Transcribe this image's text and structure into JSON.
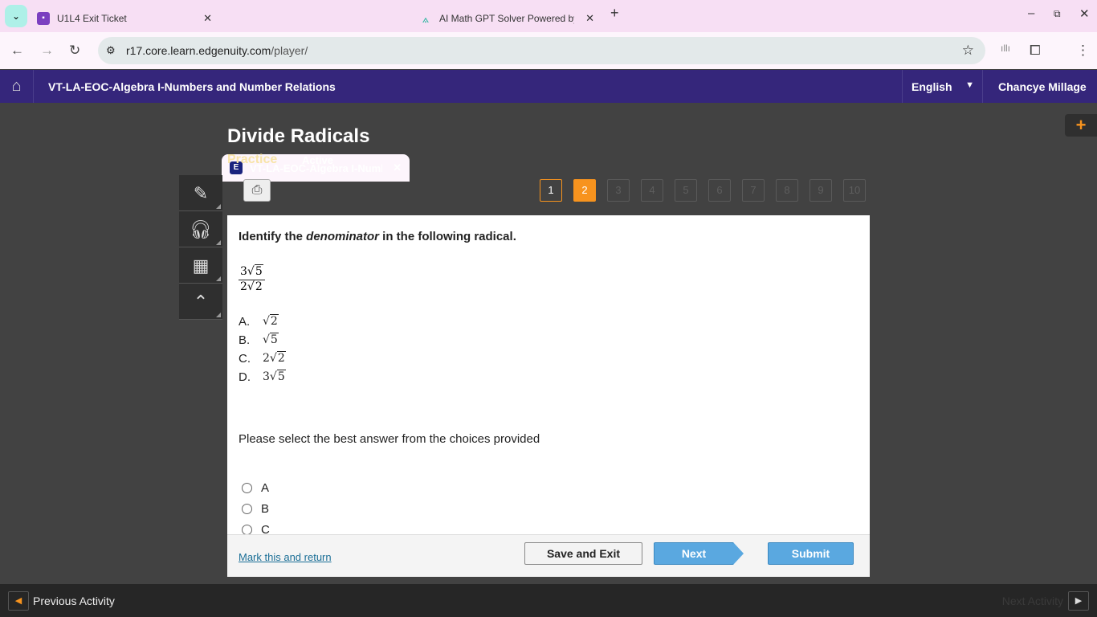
{
  "browser": {
    "tabs": [
      {
        "title": "U1L4 Exit Ticket",
        "icon": "classroom-icon",
        "color": "#7b3fc0"
      },
      {
        "title": "VT-LA-EOC-Algebra I-Numbers and Number Relations",
        "icon": "edgenuity-icon",
        "color": "#1a237e",
        "active": true
      },
      {
        "title": "AI Math GPT Solver Powered by AI",
        "icon": "compass-icon",
        "color": "#2bb5a0"
      }
    ],
    "url_host": "r17.core.learn.edgenuity.com",
    "url_path": "/player/"
  },
  "header": {
    "course": "VT-LA-EOC-Algebra I-Numbers and Number Relations",
    "language": "English",
    "user": "Chancye Millage"
  },
  "lesson": {
    "title": "Divide Radicals",
    "type": "Practice",
    "status": "Active"
  },
  "pages": {
    "items": [
      "1",
      "2",
      "3",
      "4",
      "5",
      "6",
      "7",
      "8",
      "9",
      "10"
    ],
    "current": 2,
    "completed": [
      1
    ]
  },
  "question": {
    "prefix": "Identify the ",
    "emph": "denominator",
    "suffix": " in the following radical.",
    "numerator": {
      "coef": "3",
      "radicand": "5"
    },
    "denominator": {
      "coef": "2",
      "radicand": "2"
    },
    "choices": [
      {
        "letter": "A.",
        "coef": "",
        "radicand": "2"
      },
      {
        "letter": "B.",
        "coef": "",
        "radicand": "5"
      },
      {
        "letter": "C.",
        "coef": "2",
        "radicand": "2"
      },
      {
        "letter": "D.",
        "coef": "3",
        "radicand": "5"
      }
    ],
    "prompt": "Please select the best answer from the choices provided",
    "options": [
      "A",
      "B",
      "C"
    ]
  },
  "footer": {
    "mark": "Mark this and return",
    "save": "Save and Exit",
    "next": "Next",
    "submit": "Submit"
  },
  "bottom": {
    "prev": "Previous Activity",
    "next": "Next Activity"
  }
}
